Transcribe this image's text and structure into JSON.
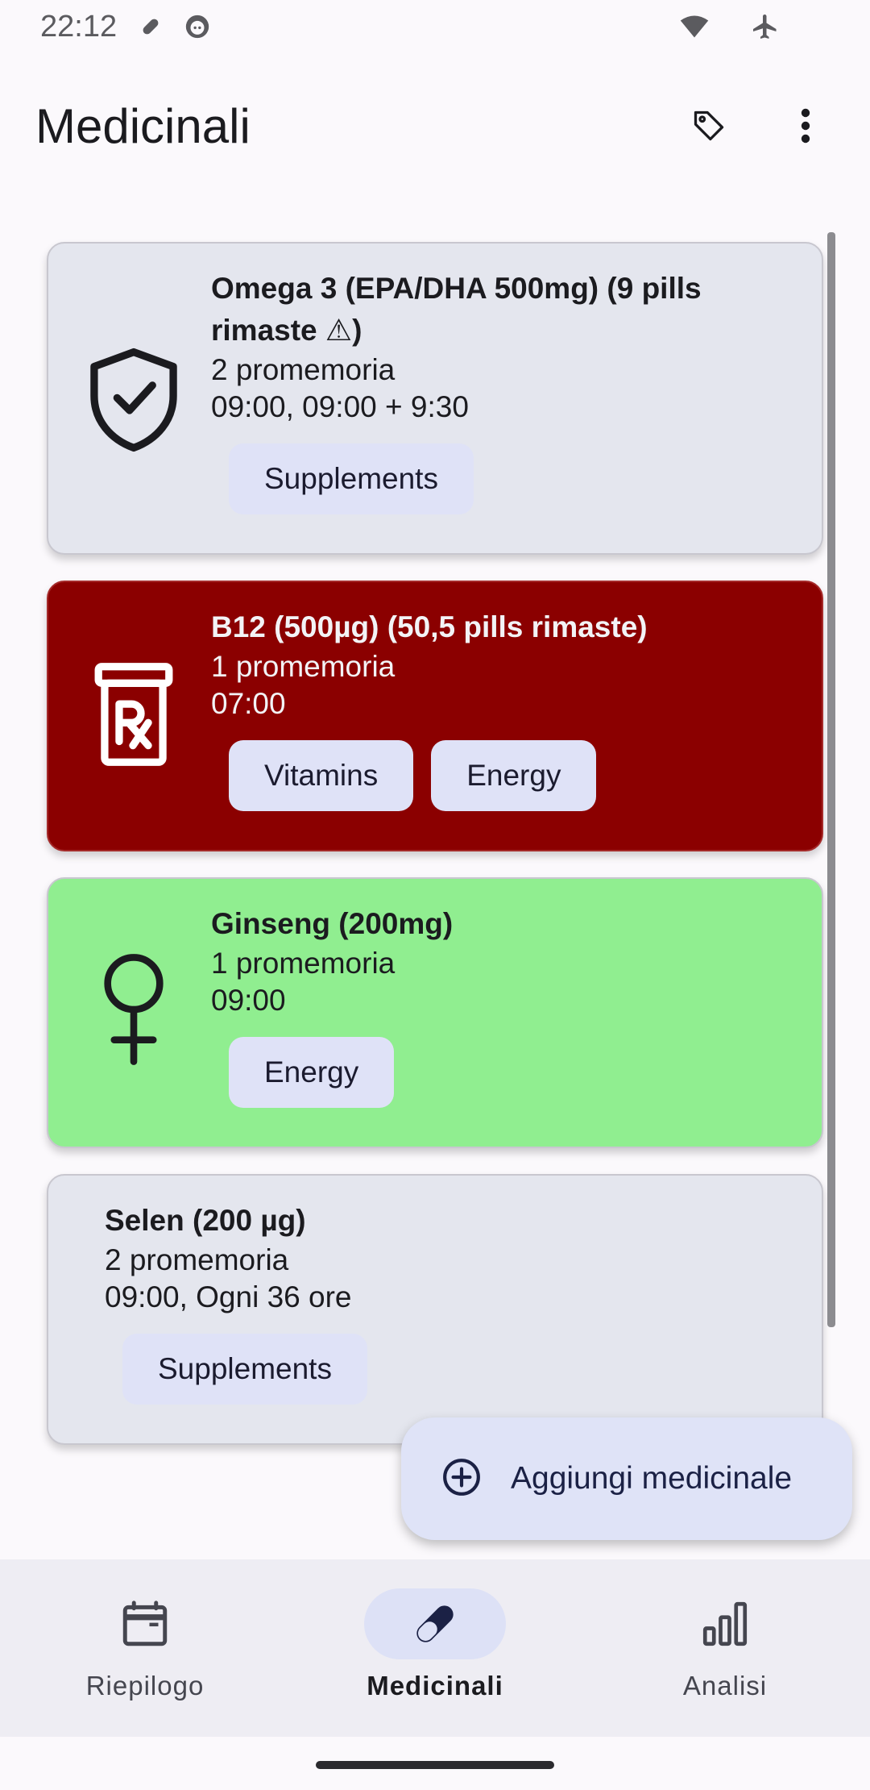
{
  "status_bar": {
    "time": "22:12",
    "icons": [
      "pill-icon",
      "face-icon",
      "wifi-icon",
      "airplane-icon"
    ]
  },
  "app_bar": {
    "title": "Medicinali",
    "actions": [
      "tag-icon",
      "more-vert-icon"
    ]
  },
  "medicines": [
    {
      "title": "Omega 3 (EPA/DHA 500mg) (9 pills rimaste ⚠)",
      "reminders": "2 promemoria",
      "times": "09:00, 09:00 + 9:30",
      "tags": [
        "Supplements"
      ],
      "icon": "shield-check-icon",
      "color": "#e4e6ee"
    },
    {
      "title": "B12 (500µg) (50,5 pills rimaste)",
      "reminders": "1 promemoria",
      "times": "07:00",
      "tags": [
        "Vitamins",
        "Energy"
      ],
      "icon": "prescription-bottle-icon",
      "color": "#8b0000"
    },
    {
      "title": "Ginseng (200mg)",
      "reminders": "1 promemoria",
      "times": "09:00",
      "tags": [
        "Energy"
      ],
      "icon": "female-symbol-icon",
      "color": "#90ee90"
    },
    {
      "title": "Selen (200 µg)",
      "reminders": "2 promemoria",
      "times": "09:00, Ogni 36 ore",
      "tags": [
        "Supplements"
      ],
      "icon": "",
      "color": "#e4e6ee"
    }
  ],
  "fab": {
    "label": "Aggiungi medicinale",
    "icon": "add-circle-icon"
  },
  "bottom_nav": [
    {
      "label": "Riepilogo",
      "icon": "calendar-icon",
      "active": false
    },
    {
      "label": "Medicinali",
      "icon": "pill-icon",
      "active": true
    },
    {
      "label": "Analisi",
      "icon": "bar-chart-icon",
      "active": false
    }
  ]
}
